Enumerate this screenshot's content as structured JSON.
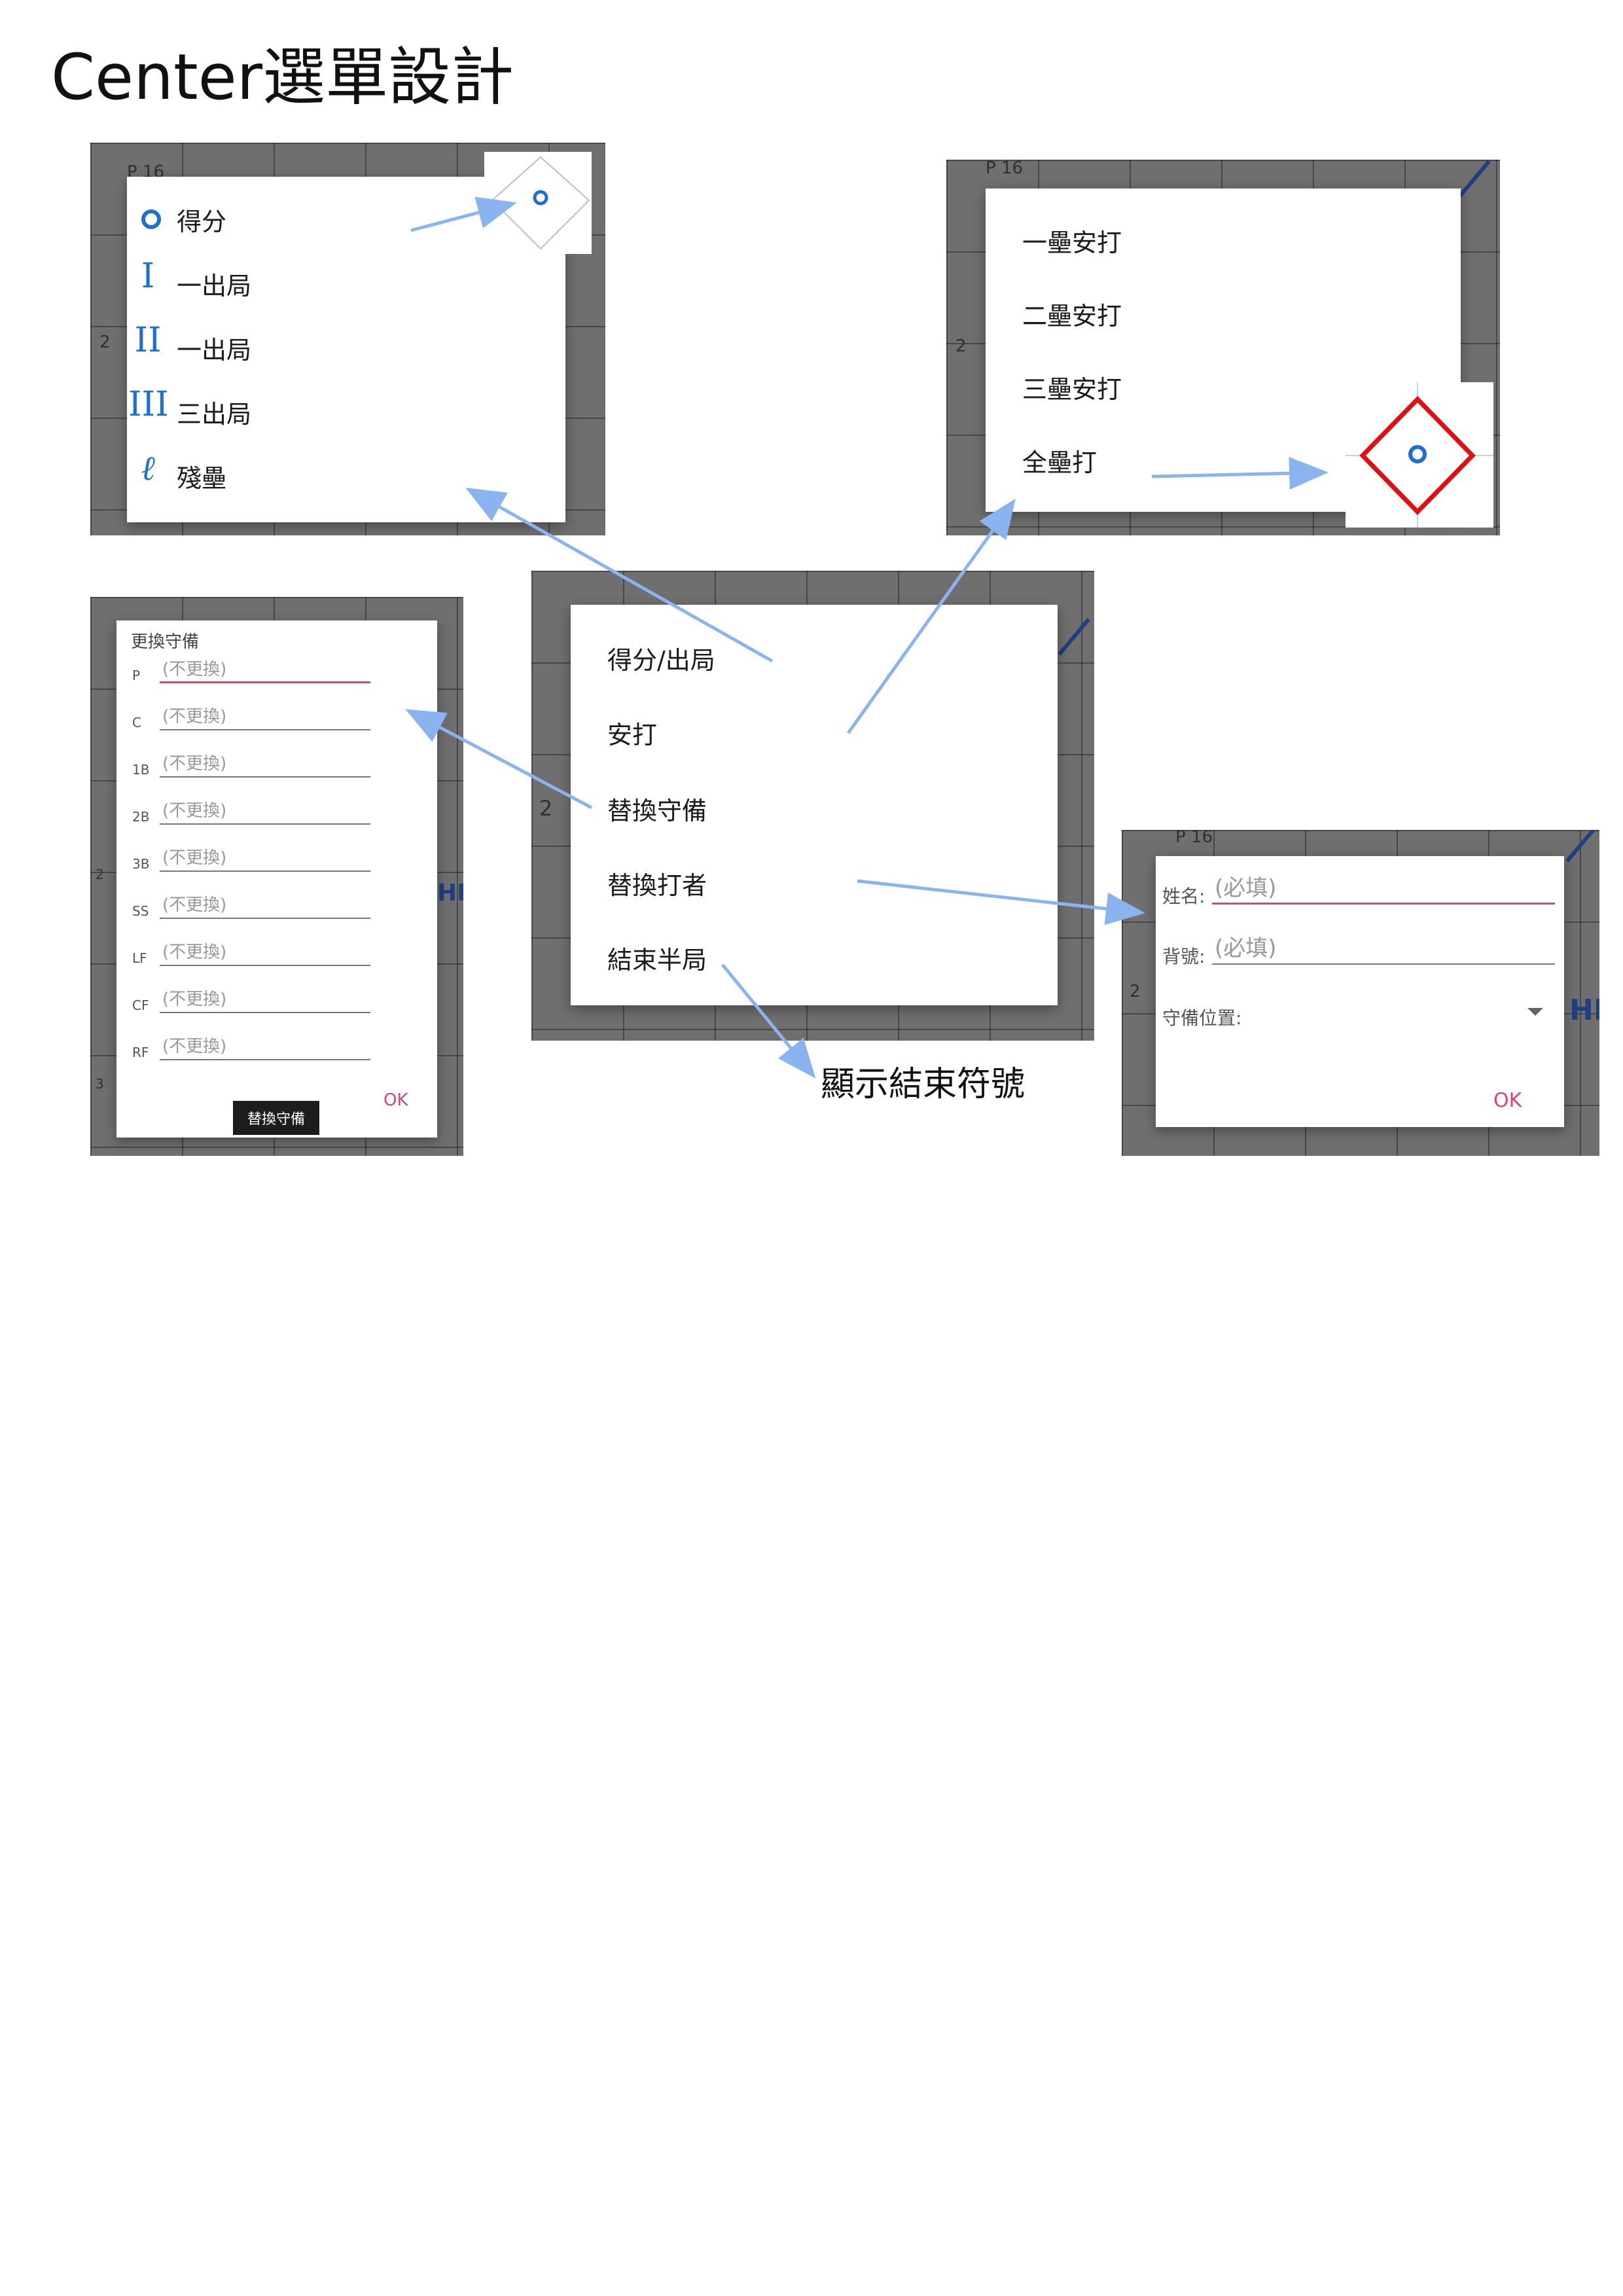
{
  "page": {
    "title": "Center選單設計"
  },
  "panel_score_out": {
    "bg_label": "P 16",
    "bg_row": "2",
    "items": [
      {
        "label": "得分",
        "icon": "circle-icon"
      },
      {
        "label": "一出局",
        "icon": "roman-one-icon",
        "glyph": "I"
      },
      {
        "label": "一出局",
        "icon": "roman-two-icon",
        "glyph": "II"
      },
      {
        "label": "三出局",
        "icon": "roman-three-icon",
        "glyph": "III"
      },
      {
        "label": "殘壘",
        "icon": "script-l-icon",
        "glyph": "ℓ"
      }
    ]
  },
  "panel_hit": {
    "bg_label": "P 16",
    "bg_row": "2",
    "items": [
      {
        "label": "一壘安打"
      },
      {
        "label": "二壘安打"
      },
      {
        "label": "三壘安打"
      },
      {
        "label": "全壘打"
      }
    ]
  },
  "panel_center_menu": {
    "bg_row": "2",
    "items": [
      {
        "label": "得分/出局"
      },
      {
        "label": "安打"
      },
      {
        "label": "替換守備"
      },
      {
        "label": "替換打者"
      },
      {
        "label": "結束半局"
      }
    ]
  },
  "panel_defense": {
    "title": "更換守備",
    "bg_row_a": "2",
    "bg_row_b": "3",
    "bg_hr": "HR",
    "fields": [
      {
        "label": "P",
        "placeholder": "(不更換)"
      },
      {
        "label": "C",
        "placeholder": "(不更換)"
      },
      {
        "label": "1B",
        "placeholder": "(不更換)"
      },
      {
        "label": "2B",
        "placeholder": "(不更換)"
      },
      {
        "label": "3B",
        "placeholder": "(不更換)"
      },
      {
        "label": "SS",
        "placeholder": "(不更換)"
      },
      {
        "label": "LF",
        "placeholder": "(不更換)"
      },
      {
        "label": "CF",
        "placeholder": "(不更換)"
      },
      {
        "label": "RF",
        "placeholder": "(不更換)"
      }
    ],
    "toast": "替換守備",
    "ok": "OK"
  },
  "panel_batter": {
    "bg_label": "P 16",
    "bg_row": "2",
    "bg_hr": "HR",
    "name_label": "姓名:",
    "name_placeholder": "(必填)",
    "number_label": "背號:",
    "number_placeholder": "(必填)",
    "position_label": "守備位置:",
    "ok": "OK"
  },
  "annotation": {
    "end_symbol": "顯示結束符號"
  },
  "colors": {
    "accent": "#e0407a",
    "icon_blue": "#1f6fd1",
    "arrow": "#8ab4f0",
    "diamond_red": "#e01010"
  }
}
